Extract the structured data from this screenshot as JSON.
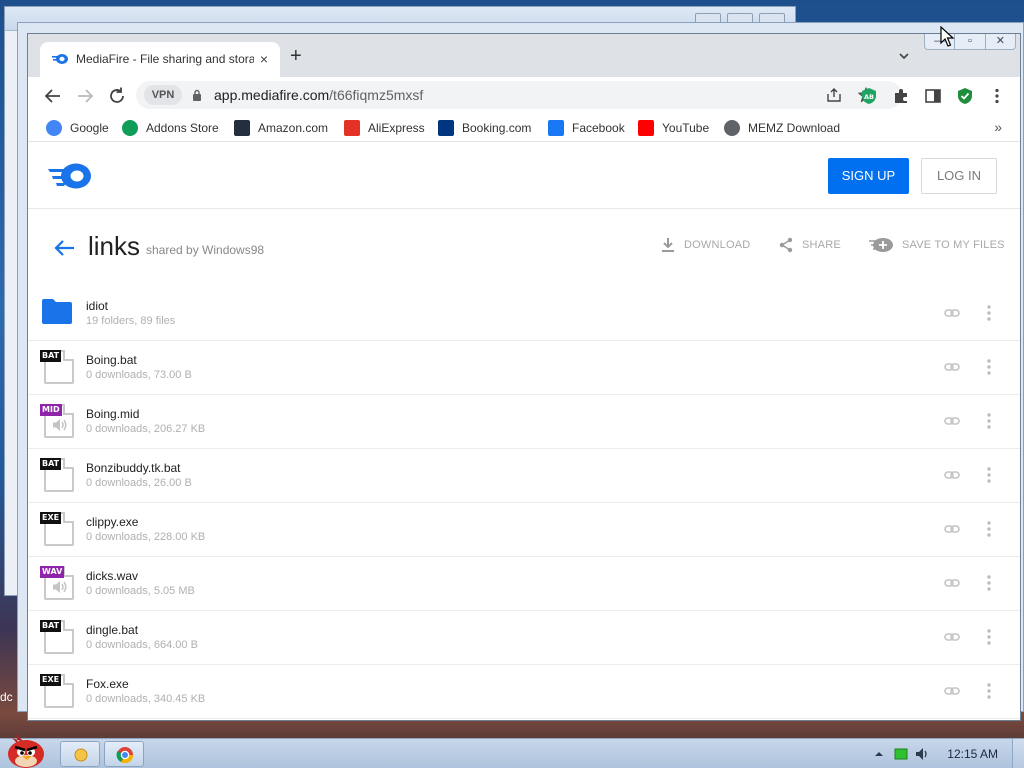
{
  "desktop": {
    "left_strip_text": "dc"
  },
  "browser": {
    "tab_title": "MediaFire - File sharing and stora",
    "tab_close": "×",
    "new_tab": "+",
    "vpn_badge": "VPN",
    "url_host": "app.mediafire.com",
    "url_path": "/t66fiqmz5mxsf",
    "window_controls": {
      "minimize": "—",
      "maximize": "▫",
      "close": "✕"
    },
    "extensions": [
      "adblock-icon",
      "puzzle-icon",
      "sidepanel-icon",
      "shield-icon",
      "kebab-menu-icon"
    ],
    "extension_adblock_label": "AB",
    "bookmarks": [
      {
        "label": "Google",
        "icon": "google-icon",
        "color": "#4285f4"
      },
      {
        "label": "Addons Store",
        "icon": "addons-store-icon",
        "color": "#0f9d58"
      },
      {
        "label": "Amazon.com",
        "icon": "amazon-icon",
        "color": "#232f3e"
      },
      {
        "label": "AliExpress",
        "icon": "aliexpress-icon",
        "color": "#e43225"
      },
      {
        "label": "Booking.com",
        "icon": "booking-icon",
        "color": "#003580"
      },
      {
        "label": "Facebook",
        "icon": "facebook-icon",
        "color": "#1877f2"
      },
      {
        "label": "YouTube",
        "icon": "youtube-icon",
        "color": "#ff0000"
      },
      {
        "label": "MEMZ Download",
        "icon": "globe-icon",
        "color": "#5f6368"
      }
    ],
    "bookmarks_more": "»"
  },
  "mediafire": {
    "signup_label": "SIGN UP",
    "login_label": "LOG IN",
    "folder_title": "links",
    "shared_by": "shared by Windows98",
    "actions": {
      "download": "DOWNLOAD",
      "share": "SHARE",
      "save": "SAVE TO MY FILES"
    },
    "brand_color": "#0070f0",
    "files": [
      {
        "name": "idiot",
        "meta": "19 folders, 89 files",
        "type": "folder",
        "badge": ""
      },
      {
        "name": "Boing.bat",
        "meta": "0 downloads, 73.00 B",
        "type": "file",
        "badge": "BAT",
        "badge_color": "#111111"
      },
      {
        "name": "Boing.mid",
        "meta": "0 downloads, 206.27 KB",
        "type": "audio",
        "badge": "MID",
        "badge_color": "#8e24aa"
      },
      {
        "name": "Bonzibuddy.tk.bat",
        "meta": "0 downloads, 26.00 B",
        "type": "file",
        "badge": "BAT",
        "badge_color": "#111111"
      },
      {
        "name": "clippy.exe",
        "meta": "0 downloads, 228.00 KB",
        "type": "file",
        "badge": "EXE",
        "badge_color": "#111111"
      },
      {
        "name": "dicks.wav",
        "meta": "0 downloads, 5.05 MB",
        "type": "audio",
        "badge": "WAV",
        "badge_color": "#8e24aa"
      },
      {
        "name": "dingle.bat",
        "meta": "0 downloads, 664.00 B",
        "type": "file",
        "badge": "BAT",
        "badge_color": "#111111"
      },
      {
        "name": "Fox.exe",
        "meta": "0 downloads, 340.45 KB",
        "type": "file",
        "badge": "EXE",
        "badge_color": "#111111"
      }
    ]
  },
  "taskbar": {
    "clock": "12:15 AM"
  }
}
